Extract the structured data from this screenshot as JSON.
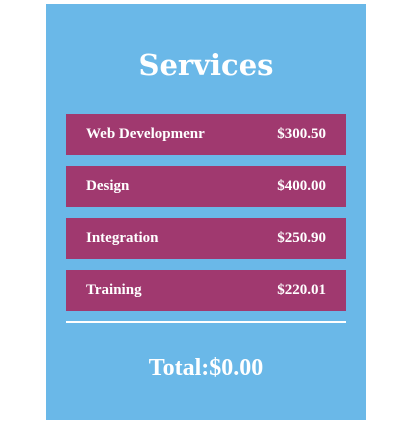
{
  "title": "Services",
  "services": [
    {
      "name": "Web Developmenr",
      "price": "$300.50"
    },
    {
      "name": "Design",
      "price": "$400.00"
    },
    {
      "name": "Integration",
      "price": "$250.90"
    },
    {
      "name": "Training",
      "price": "$220.01"
    }
  ],
  "total": "Total:$0.00",
  "colors": {
    "panel_background": "#6ab8e8",
    "item_background": "#a0396f",
    "text": "#ffffff"
  }
}
